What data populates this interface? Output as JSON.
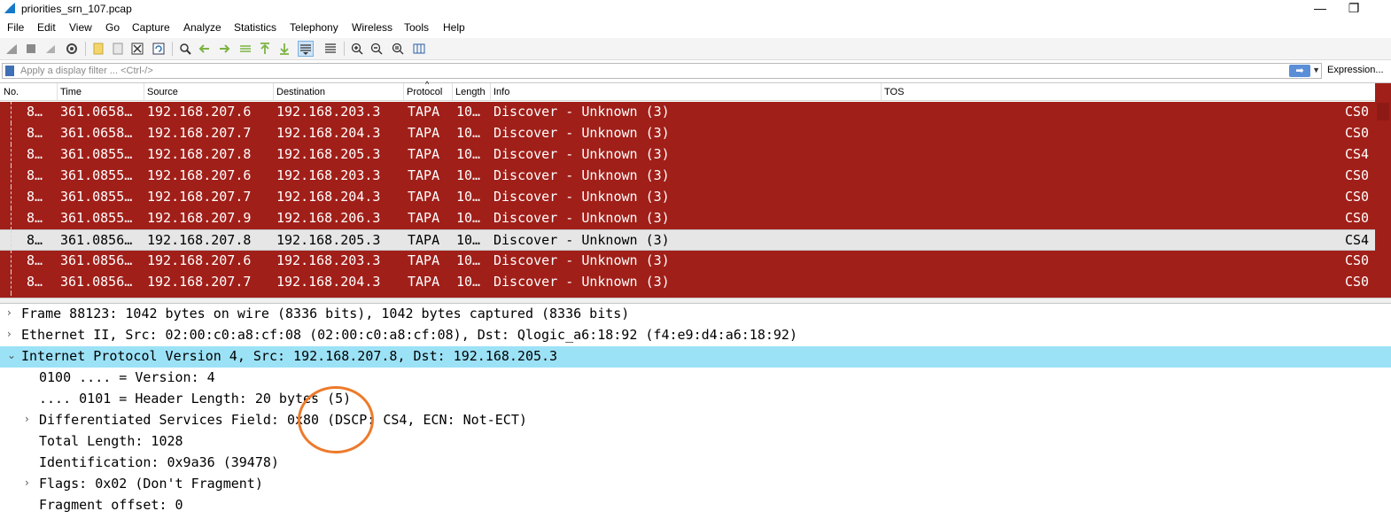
{
  "window": {
    "title": "priorities_srn_107.pcap",
    "minimize": "—",
    "restore": "❐"
  },
  "menu": [
    "File",
    "Edit",
    "View",
    "Go",
    "Capture",
    "Analyze",
    "Statistics",
    "Telephony",
    "Wireless",
    "Tools",
    "Help"
  ],
  "toolbar": {
    "icons": [
      "shark-start-icon",
      "stop-icon",
      "restart-icon",
      "options-icon",
      "open-file-icon",
      "save-file-icon",
      "close-file-icon",
      "reload-icon",
      "find-icon",
      "go-back-icon",
      "go-forward-icon",
      "go-to-packet-icon",
      "go-first-icon",
      "go-last-icon",
      "autoscroll-icon",
      "colorize-icon",
      "zoom-in-icon",
      "zoom-out-icon",
      "zoom-normal-icon",
      "resize-columns-icon"
    ],
    "selected": [
      "autoscroll-icon"
    ]
  },
  "filter": {
    "placeholder": "Apply a display filter ... <Ctrl-/>",
    "apply_label": "➡",
    "expression_label": "Expression..."
  },
  "packet_list": {
    "columns": [
      "No.",
      "Time",
      "Source",
      "Destination",
      "Protocol",
      "Length",
      "Info",
      "TOS"
    ],
    "rows": [
      {
        "no": "8…",
        "time": "361.0658…",
        "src": "192.168.207.6",
        "dst": "192.168.203.3",
        "proto": "TAPA",
        "len": "10…",
        "info": "Discover - Unknown (3)",
        "tos": "CS0",
        "selected": false
      },
      {
        "no": "8…",
        "time": "361.0658…",
        "src": "192.168.207.7",
        "dst": "192.168.204.3",
        "proto": "TAPA",
        "len": "10…",
        "info": "Discover - Unknown (3)",
        "tos": "CS0",
        "selected": false
      },
      {
        "no": "8…",
        "time": "361.0855…",
        "src": "192.168.207.8",
        "dst": "192.168.205.3",
        "proto": "TAPA",
        "len": "10…",
        "info": "Discover - Unknown (3)",
        "tos": "CS4",
        "selected": false
      },
      {
        "no": "8…",
        "time": "361.0855…",
        "src": "192.168.207.6",
        "dst": "192.168.203.3",
        "proto": "TAPA",
        "len": "10…",
        "info": "Discover - Unknown (3)",
        "tos": "CS0",
        "selected": false
      },
      {
        "no": "8…",
        "time": "361.0855…",
        "src": "192.168.207.7",
        "dst": "192.168.204.3",
        "proto": "TAPA",
        "len": "10…",
        "info": "Discover - Unknown (3)",
        "tos": "CS0",
        "selected": false
      },
      {
        "no": "8…",
        "time": "361.0855…",
        "src": "192.168.207.9",
        "dst": "192.168.206.3",
        "proto": "TAPA",
        "len": "10…",
        "info": "Discover - Unknown (3)",
        "tos": "CS0",
        "selected": false
      },
      {
        "no": "8…",
        "time": "361.0856…",
        "src": "192.168.207.8",
        "dst": "192.168.205.3",
        "proto": "TAPA",
        "len": "10…",
        "info": "Discover - Unknown (3)",
        "tos": "CS4",
        "selected": true
      },
      {
        "no": "8…",
        "time": "361.0856…",
        "src": "192.168.207.6",
        "dst": "192.168.203.3",
        "proto": "TAPA",
        "len": "10…",
        "info": "Discover - Unknown (3)",
        "tos": "CS0",
        "selected": false
      },
      {
        "no": "8…",
        "time": "361.0856…",
        "src": "192.168.207.7",
        "dst": "192.168.204.3",
        "proto": "TAPA",
        "len": "10…",
        "info": "Discover - Unknown (3)",
        "tos": "CS0",
        "selected": false
      },
      {
        "no": "",
        "time": "",
        "src": "",
        "dst": "",
        "proto": "",
        "len": "",
        "info": "",
        "tos": "",
        "selected": false
      }
    ]
  },
  "details": [
    {
      "level": 0,
      "arrow": "›",
      "text": "Frame 88123: 1042 bytes on wire (8336 bits), 1042 bytes captured (8336 bits)",
      "highlight": false
    },
    {
      "level": 0,
      "arrow": "›",
      "text": "Ethernet II, Src: 02:00:c0:a8:cf:08 (02:00:c0:a8:cf:08), Dst: Qlogic_a6:18:92 (f4:e9:d4:a6:18:92)",
      "highlight": false
    },
    {
      "level": 0,
      "arrow": "⌄",
      "text": "Internet Protocol Version 4, Src: 192.168.207.8, Dst: 192.168.205.3",
      "highlight": true
    },
    {
      "level": 1,
      "arrow": "",
      "text": "0100 .... = Version: 4",
      "highlight": false
    },
    {
      "level": 1,
      "arrow": "",
      "text": ".... 0101 = Header Length: 20 bytes (5)",
      "highlight": false
    },
    {
      "level": 1,
      "arrow": "›",
      "text": "Differentiated Services Field: 0x80 (DSCP: CS4, ECN: Not-ECT)",
      "highlight": false
    },
    {
      "level": 1,
      "arrow": "",
      "text": "Total Length: 1028",
      "highlight": false
    },
    {
      "level": 1,
      "arrow": "",
      "text": "Identification: 0x9a36 (39478)",
      "highlight": false
    },
    {
      "level": 1,
      "arrow": "›",
      "text": "Flags: 0x02 (Don't Fragment)",
      "highlight": false
    },
    {
      "level": 1,
      "arrow": "",
      "text": "Fragment offset: 0",
      "highlight": false
    }
  ],
  "colors": {
    "row_bg": "#a11f19",
    "row_fg": "#ffffff",
    "selected_row_bg": "#e6e6e6",
    "detail_highlight": "#9ce2f7",
    "annotation": "#ed7a2b"
  }
}
